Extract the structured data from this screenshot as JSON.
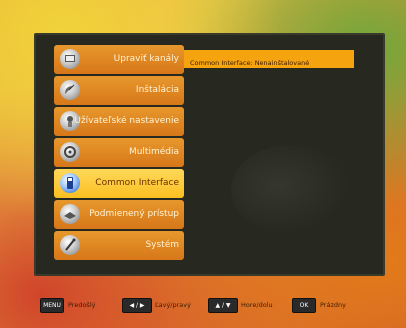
{
  "menu": {
    "items": [
      {
        "label": "Upraviť kanály",
        "icon": "edit-channels-icon"
      },
      {
        "label": "Inštalácia",
        "icon": "satellite-dish-icon"
      },
      {
        "label": "Užívateľské nastavenie",
        "icon": "user-settings-icon"
      },
      {
        "label": "Multimédia",
        "icon": "multimedia-icon"
      },
      {
        "label": "Common Interface",
        "icon": "ci-card-icon",
        "selected": true
      },
      {
        "label": "Podmienený prístup",
        "icon": "conditional-access-icon"
      },
      {
        "label": "Systém",
        "icon": "system-icon"
      }
    ]
  },
  "info": {
    "text": "Common Interface: Nenainštalované"
  },
  "footer": {
    "menu_key": "MENU",
    "menu_label": "Predošlý",
    "lr_key": "◀ / ▶",
    "lr_label": "Ľavý/pravý",
    "ud_key": "▲ / ▼",
    "ud_label": "Hore/dolu",
    "ok_key": "OK",
    "ok_label": "Prázdny"
  },
  "colors": {
    "menu_item": "#e08a24",
    "menu_item_active": "#fbbf21",
    "panel": "#272820",
    "info_bar": "#f5a410"
  }
}
